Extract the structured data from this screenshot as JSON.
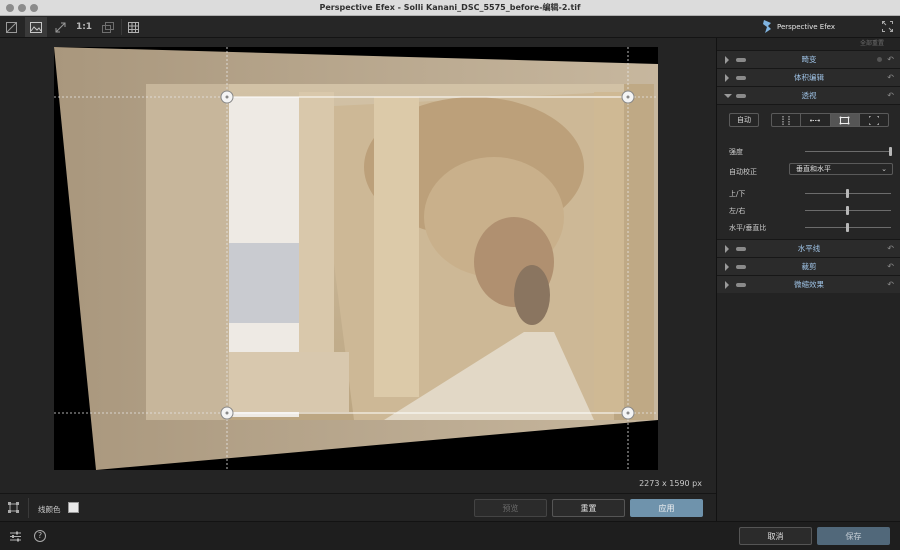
{
  "window": {
    "title": "Perspective Efex - Solli Kanani_DSC_5575_before-编辑-2.tif"
  },
  "toolbar": {
    "items": [
      {
        "icon": "split-view-icon"
      },
      {
        "icon": "image-view-icon"
      },
      {
        "icon": "fit-screen-icon"
      },
      {
        "label": "1:1"
      },
      {
        "icon": "compare-icon"
      },
      {
        "icon": "grid-icon"
      }
    ],
    "brand": "Perspective Efex"
  },
  "canvas": {
    "dimensions": "2273 x 1590 px"
  },
  "bottombar": {
    "line_color_label": "线颜色",
    "preview_label": "预览",
    "reset_label": "重置",
    "apply_label": "应用"
  },
  "footer": {
    "cancel_label": "取消",
    "save_label": "保存"
  },
  "panel": {
    "reset_all": "全部重置",
    "sections": {
      "distortion": "畸变",
      "volume": "体积编辑",
      "perspective": "透视",
      "horizon": "水平线",
      "crop": "裁剪",
      "miniature": "微缩效果"
    },
    "perspective": {
      "auto_label": "自动",
      "strength_label": "强度",
      "auto_correct_label": "自动校正",
      "auto_correct_value": "垂直和水平",
      "updown_label": "上/下",
      "leftright_label": "左/右",
      "ratio_label": "水平/垂直比"
    }
  },
  "colors": {
    "accent": "#6f93ac",
    "section_label": "#9fc3e6"
  }
}
